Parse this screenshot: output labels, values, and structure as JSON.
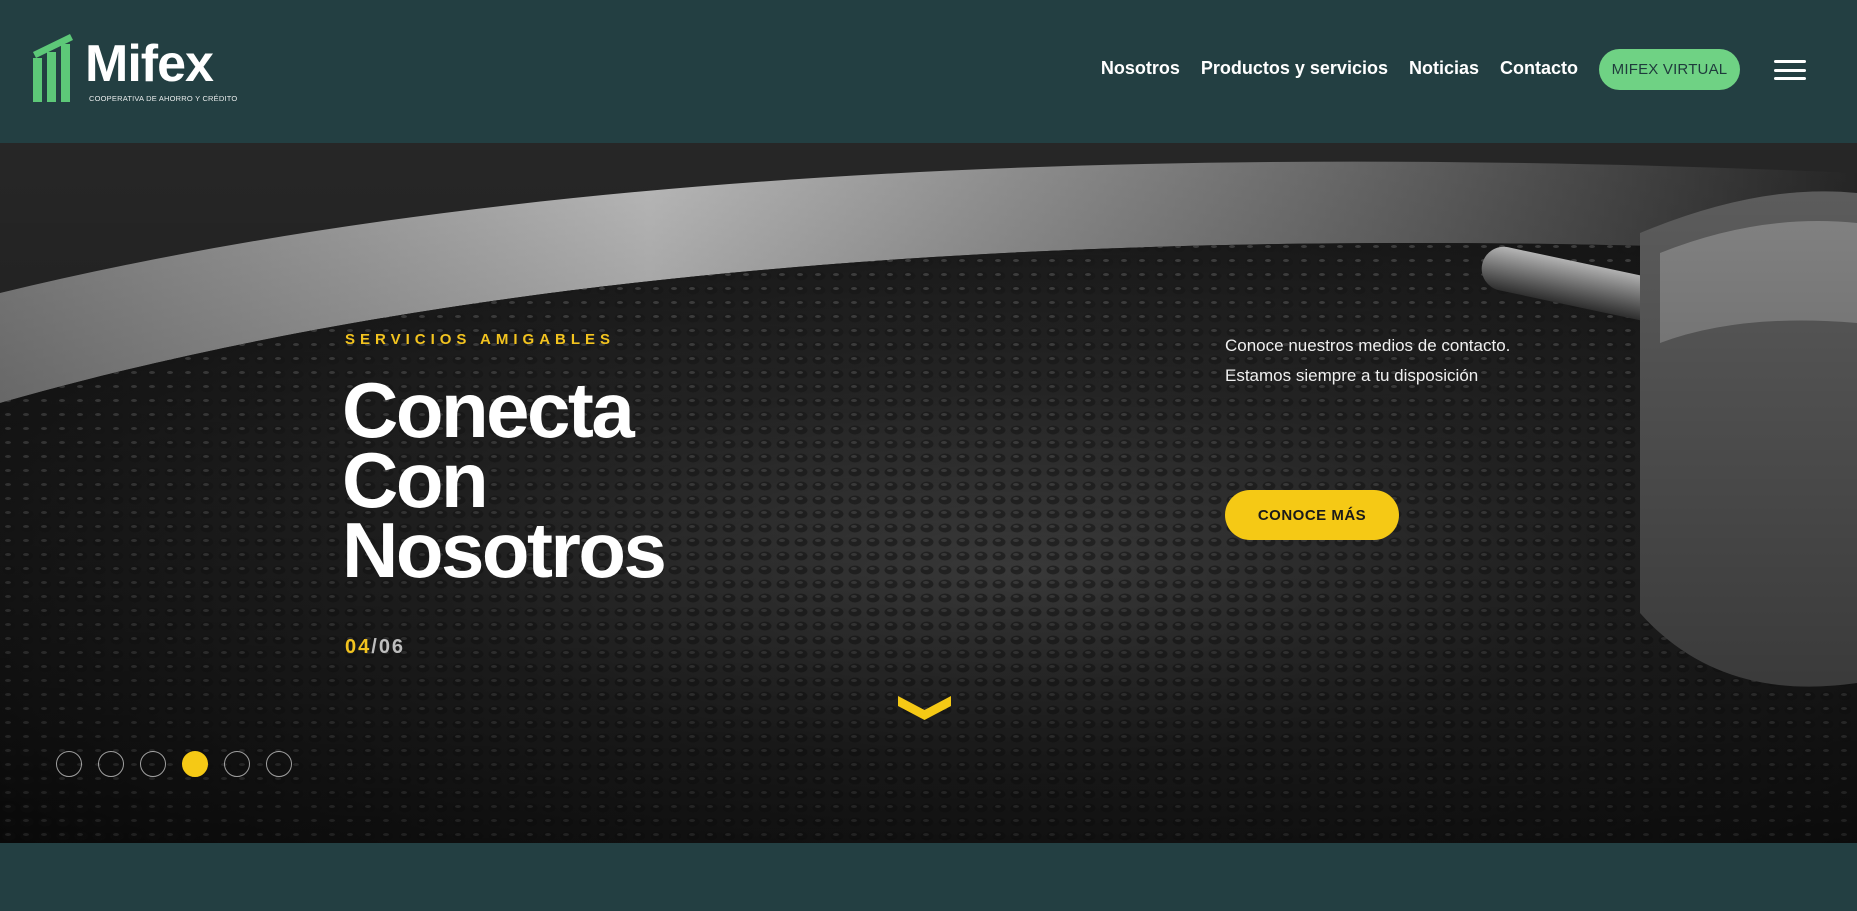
{
  "brand": {
    "name": "Mifex",
    "tagline": "COOPERATIVA DE AHORRO Y CRÉDITO",
    "accent_green": "#6fd284",
    "accent_yellow": "#f5c915",
    "header_bg": "#233f42"
  },
  "nav": {
    "links": [
      "Nosotros",
      "Productos y servicios",
      "Noticias",
      "Contacto"
    ],
    "cta_label": "MIFEX VIRTUAL",
    "menu_icon": "hamburger-icon"
  },
  "hero": {
    "eyebrow": "SERVICIOS AMIGABLES",
    "headline": [
      "Conecta",
      "Con",
      "Nosotros"
    ],
    "counter_current": "04",
    "counter_separator": "/",
    "counter_total": "06",
    "description": "Conoce nuestros medios de contacto. Estamos siempre a tu disposición",
    "cta_label": "CONOCE MÁS",
    "scroll_icon": "chevron-down-icon",
    "slides_total": 6,
    "active_slide": 4
  }
}
